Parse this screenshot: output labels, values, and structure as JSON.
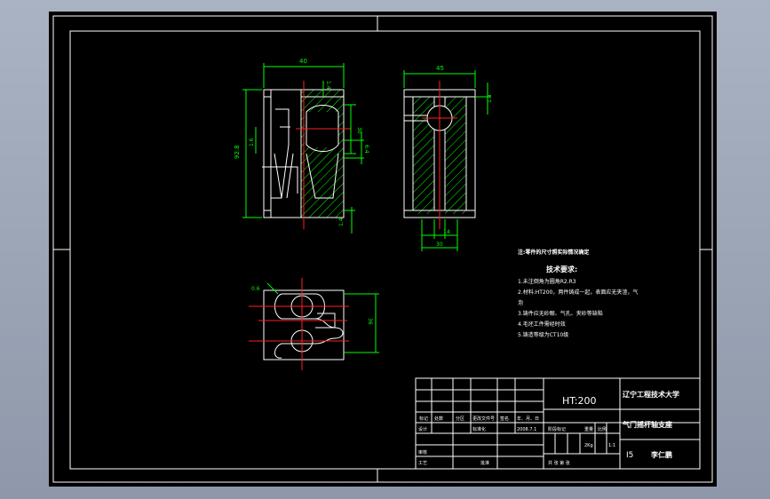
{
  "dims": {
    "top_width": "40",
    "top_r14": "1.4",
    "top_30": "30",
    "top_64": "6.4",
    "left_height": "92.8",
    "left_16": "1.6",
    "bottom_14": "1.4",
    "side_width": "45",
    "side_14": "1.4",
    "side_bottom_14": "14",
    "side_bottom_30": "30",
    "plan_06": "0.6",
    "plan_36": "36"
  },
  "notes": {
    "header": "注:零件的尺寸照实际情况确定",
    "title": "技术要求:",
    "items": [
      "1.未注倒角为圆角R2.R3",
      "2.材料:HT200，两件铸成一起，表面应无夹渣，气",
      "泡",
      "3.铸件应无砂眼、气孔、夹砂等缺陷",
      "4.毛坯工件需经时效",
      "5.铸造等级为CT10级"
    ]
  },
  "title_block": {
    "material": "HT:200",
    "school": "辽宁工程技术大学",
    "part_name": "气门摇杆轴支座",
    "drawing_no": "I5",
    "author": "李仁鹏",
    "rev_labels": [
      "标记",
      "处数",
      "分区",
      "更改文件号",
      "签名",
      "年、月、日"
    ],
    "row_design": "设计",
    "row_std": "标准化",
    "date": "2008.7.1",
    "stage_label": "阶段标记",
    "weight_label": "重量",
    "scale_label": "比例",
    "weight_val": "2Kg",
    "scale_val": "1:1",
    "review": "审核",
    "process": "工艺",
    "approve": "批准",
    "sheet_info": "共  张  第  张"
  }
}
